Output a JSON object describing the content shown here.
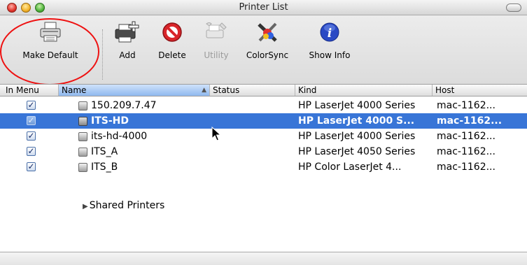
{
  "window": {
    "title": "Printer List"
  },
  "toolbar": {
    "make_default": "Make Default",
    "add": "Add",
    "delete": "Delete",
    "utility": "Utility",
    "colorsync": "ColorSync",
    "show_info": "Show Info"
  },
  "columns": {
    "in_menu": "In Menu",
    "name": "Name",
    "status": "Status",
    "kind": "Kind",
    "host": "Host"
  },
  "printers": [
    {
      "in_menu": true,
      "name": "150.209.7.47",
      "status": "",
      "kind": "HP LaserJet 4000 Series",
      "host": "mac-1162...",
      "selected": false
    },
    {
      "in_menu": true,
      "name": "ITS-HD",
      "status": "",
      "kind": "HP LaserJet 4000 S...",
      "host": "mac-1162...",
      "selected": true
    },
    {
      "in_menu": true,
      "name": "its-hd-4000",
      "status": "",
      "kind": "HP LaserJet 4000 Series",
      "host": "mac-1162...",
      "selected": false
    },
    {
      "in_menu": true,
      "name": "ITS_A",
      "status": "",
      "kind": "HP LaserJet 4050 Series",
      "host": "mac-1162...",
      "selected": false
    },
    {
      "in_menu": true,
      "name": "ITS_B",
      "status": "",
      "kind": "HP Color LaserJet 4...",
      "host": "mac-1162...",
      "selected": false
    }
  ],
  "shared_group": {
    "label": "Shared Printers",
    "expanded": false
  },
  "colors": {
    "selection": "#3875d7",
    "annotation": "#ee1111"
  },
  "icons": {
    "make_default": "printer-icon",
    "add": "add-printer-icon",
    "delete": "delete-icon",
    "utility": "utility-icon",
    "colorsync": "colorsync-icon",
    "show_info": "info-icon"
  }
}
